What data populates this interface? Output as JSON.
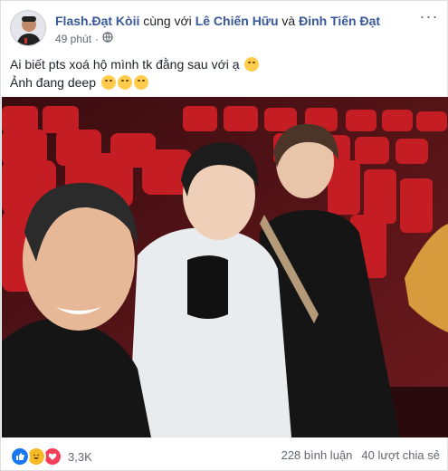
{
  "post": {
    "author": "Flash.Đạt Kòii",
    "with_text": "cùng với",
    "tagged1": "Lê Chiến Hữu",
    "and_text": "và",
    "tagged2": "Đinh Tiến Đạt",
    "time": "49 phút",
    "privacy_separator": "·",
    "text_line1": "Ai biết pts xoá hộ mình tk đằng sau với ạ",
    "text_line2": "Ảnh đang deep",
    "more_label": "···"
  },
  "footer": {
    "reaction_count": "3,3K",
    "comments": "228 bình luận",
    "shares": "40 lượt chia sẻ"
  },
  "colors": {
    "link": "#385898",
    "like": "#1877f2",
    "haha": "#f7b928",
    "love": "#f33e58",
    "seat_red": "#c51d24"
  },
  "icons": [
    "globe-icon",
    "thinking-emoji",
    "unamused-emoji",
    "like-icon",
    "haha-icon",
    "love-icon",
    "more-icon"
  ]
}
